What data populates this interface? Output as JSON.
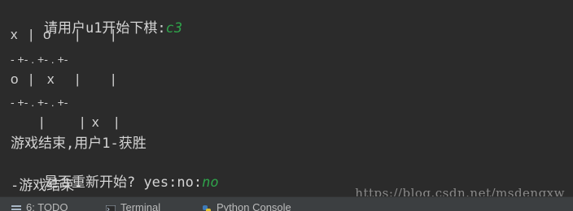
{
  "console": {
    "lines": {
      "prompt_prefix": "请用户u1开始下棋:",
      "prompt_input": "c3",
      "game_over": "游戏结束,用户1-获胜",
      "restart_prefix": "是否重新开始? yes:no:",
      "restart_input": "no",
      "end": "-游戏结束-"
    },
    "board": {
      "rows": [
        [
          "x",
          "o",
          ""
        ],
        [
          "o",
          "x",
          ""
        ],
        [
          "",
          "x",
          ""
        ]
      ],
      "separator": "- +- . +- . +-"
    }
  },
  "watermark": "https://blog.csdn.net/msdengxw",
  "tool_tabs": {
    "todo": "6: TODO",
    "terminal": "Terminal",
    "python_console": "Python Console"
  },
  "colors": {
    "background": "#2b2b2b",
    "text": "#d4d4d4",
    "user_input": "#2fa24a"
  }
}
